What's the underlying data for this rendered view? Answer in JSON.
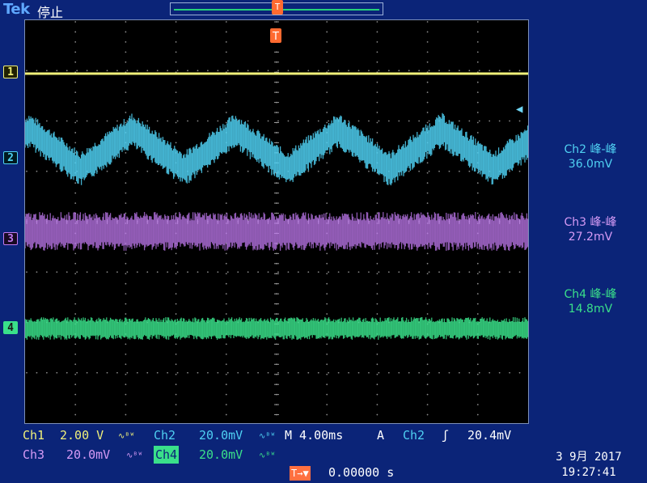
{
  "topbar": {
    "brand": "Tek",
    "state": "停止"
  },
  "trigger_marker_top": "T",
  "trigger_marker_screen": "T",
  "channels": {
    "ch1": {
      "marker": "1",
      "color": "#f0f07a"
    },
    "ch2": {
      "marker": "2",
      "color": "#4fd0f2"
    },
    "ch3": {
      "marker": "3",
      "color": "#c07af0"
    },
    "ch4": {
      "marker": "4",
      "color": "#3ae08a"
    }
  },
  "measurements": [
    {
      "label": "Ch2 峰-峰",
      "value": "36.0mV",
      "color": "#4fd0f2"
    },
    {
      "label": "Ch3 峰-峰",
      "value": "27.2mV",
      "color": "#d59af5"
    },
    {
      "label": "Ch4 峰-峰",
      "value": "14.8mV",
      "color": "#3ae08a"
    }
  ],
  "status": {
    "ch1_label": "Ch1",
    "ch1_scale": "2.00 V",
    "ch2_label": "Ch2",
    "ch2_scale": "20.0mV",
    "timebase": "M 4.00ms",
    "trigger_mode": "A",
    "trigger_source": "Ch2",
    "trigger_slope": "ʃ",
    "trigger_level": "20.4mV",
    "ch3_label": "Ch3",
    "ch3_scale": "20.0mV",
    "ch4_label": "Ch4",
    "ch4_scale": "20.0mV",
    "trigger_position_icon": "T→▼",
    "trigger_position": "0.00000 s",
    "bw_symbol": "∿ᴮᵂ",
    "bw_symbol_ch4": "∿ᴮᵂ"
  },
  "datetime": {
    "date": "3 9月 2017",
    "time": "19:27:41"
  },
  "icons": {
    "trigger_level_arrow": "◀"
  }
}
